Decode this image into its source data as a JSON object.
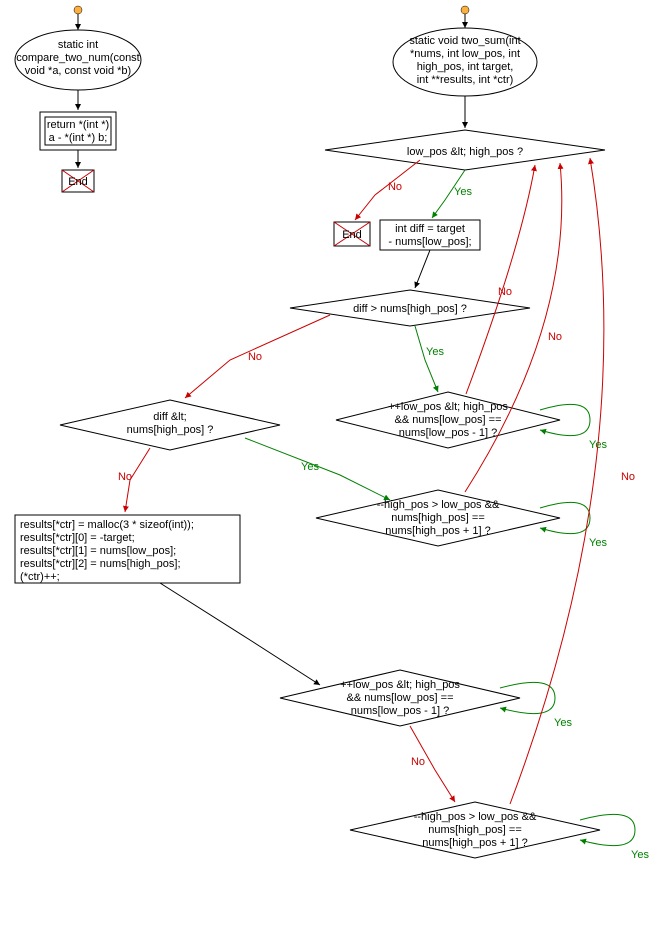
{
  "flowchart_left": {
    "start": {
      "lines": [
        "static int",
        "compare_two_num(const",
        "void *a, const void *b)"
      ]
    },
    "return_box": {
      "lines": [
        "return *(int *)",
        "a - *(int *) b;"
      ]
    },
    "end": "End"
  },
  "flowchart_right": {
    "start": {
      "lines": [
        "static void two_sum(int",
        "*nums, int low_pos, int",
        "high_pos, int target,",
        "int **results, int *ctr)"
      ]
    },
    "cond_main": "low_pos &lt; high_pos ?",
    "end": "End",
    "calc_diff": {
      "lines": [
        "int diff = target",
        "- nums[low_pos];"
      ]
    },
    "cond_diff_gt": "diff > nums[high_pos] ?",
    "cond_diff_lt": {
      "lines": [
        "diff &lt;",
        "nums[high_pos] ?"
      ]
    },
    "loop_inc_low_a": {
      "lines": [
        "++low_pos &lt; high_pos",
        "&& nums[low_pos] ==",
        "nums[low_pos - 1] ?"
      ]
    },
    "loop_dec_high_a": {
      "lines": [
        "--high_pos > low_pos &&",
        "nums[high_pos] ==",
        "nums[high_pos + 1] ?"
      ]
    },
    "results_box": {
      "lines": [
        "results[*ctr] = malloc(3 * sizeof(int));",
        "results[*ctr][0] = -target;",
        "results[*ctr][1] = nums[low_pos];",
        "results[*ctr][2] = nums[high_pos];",
        "(*ctr)++;"
      ]
    },
    "loop_inc_low_b": {
      "lines": [
        "++low_pos &lt; high_pos",
        "&& nums[low_pos] ==",
        "nums[low_pos - 1] ?"
      ]
    },
    "loop_dec_high_b": {
      "lines": [
        "--high_pos > low_pos &&",
        "nums[high_pos] ==",
        "nums[high_pos + 1] ?"
      ]
    }
  },
  "labels": {
    "yes": "Yes",
    "no": "No"
  }
}
